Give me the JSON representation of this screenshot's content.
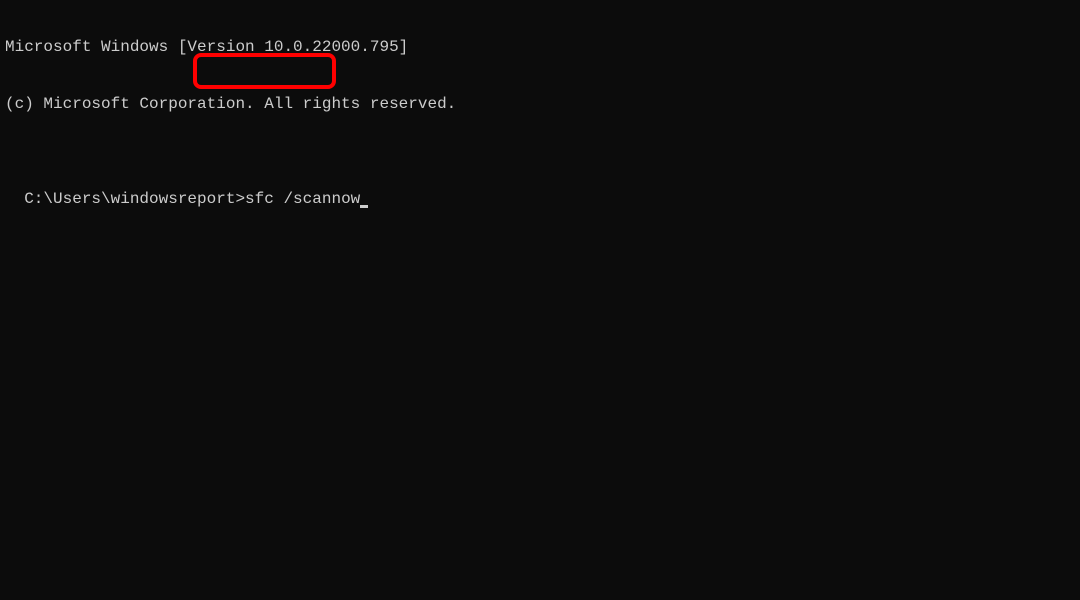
{
  "header": {
    "line1": "Microsoft Windows [Version 10.0.22000.795]",
    "line2": "(c) Microsoft Corporation. All rights reserved."
  },
  "prompt": {
    "path": "C:\\Users\\windowsreport>",
    "command": "sfc /scannow"
  }
}
